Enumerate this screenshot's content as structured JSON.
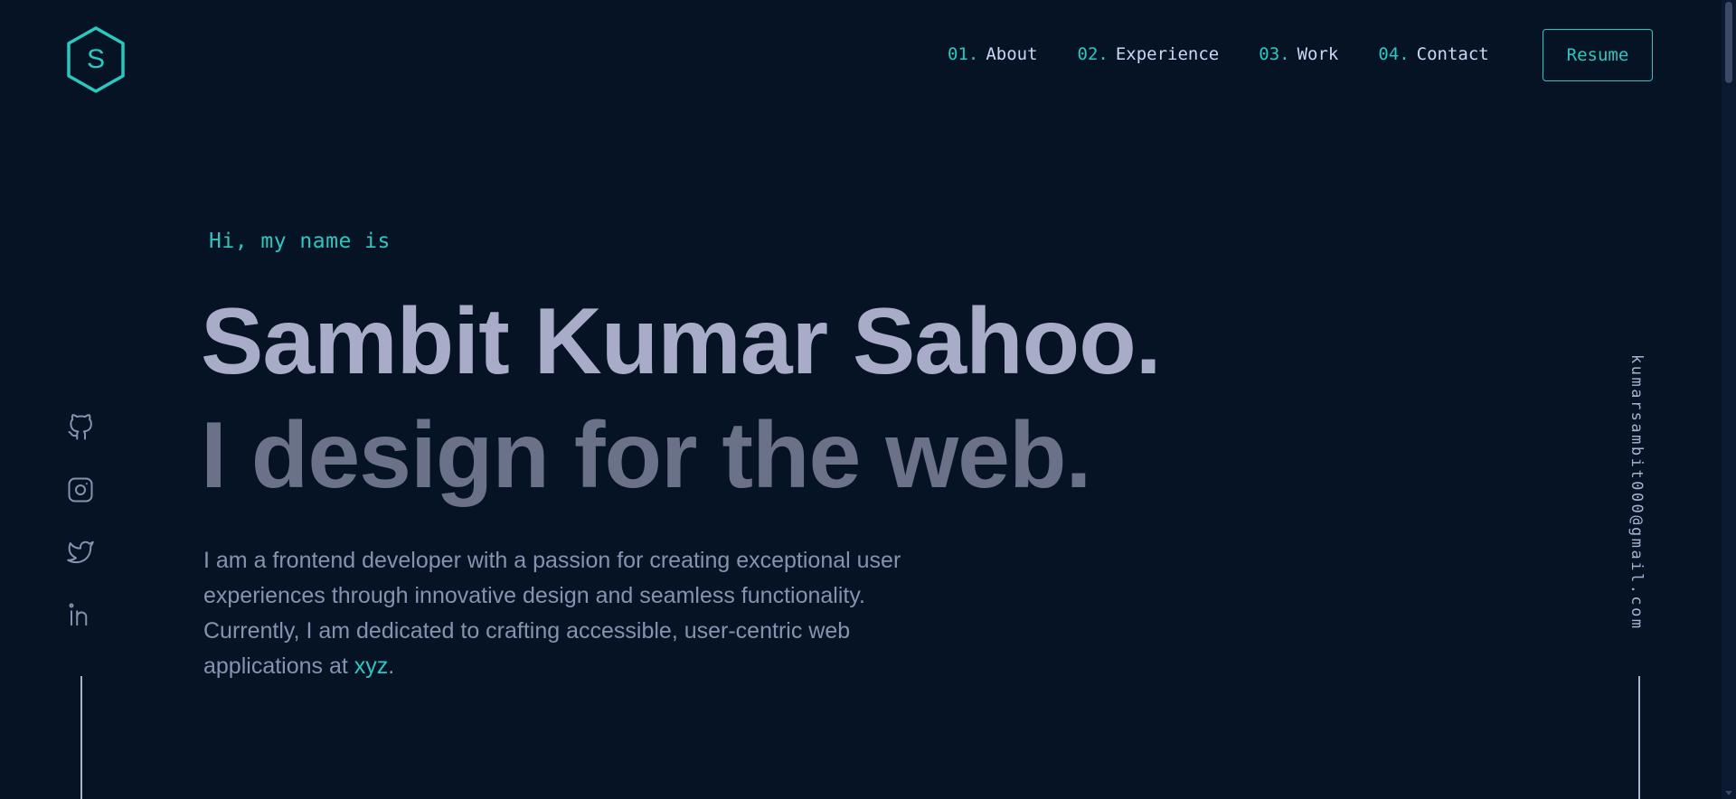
{
  "logo": {
    "letter": "S",
    "color": "#2bc8bf"
  },
  "nav": {
    "items": [
      {
        "num": "01.",
        "label": "About"
      },
      {
        "num": "02.",
        "label": "Experience"
      },
      {
        "num": "03.",
        "label": "Work"
      },
      {
        "num": "04.",
        "label": "Contact"
      }
    ],
    "resume_label": "Resume"
  },
  "hero": {
    "greeting": "Hi, my name is",
    "name": "Sambit Kumar Sahoo.",
    "tagline": "I design for the web.",
    "bio_text": "I am a frontend developer with a passion for creating exceptional user experiences through innovative design and seamless functionality. Currently, I am dedicated to crafting accessible, user-centric web applications at ",
    "bio_link": "xyz",
    "bio_end": "."
  },
  "social": {
    "icons": [
      "github-icon",
      "instagram-icon",
      "twitter-icon",
      "linkedin-icon"
    ]
  },
  "email": "kumarsambit000@gmail.com",
  "colors": {
    "background": "#061325",
    "accent": "#2bc8bf",
    "heading": "#a8acc9",
    "subheading": "#6a7188",
    "text": "#8892b0"
  }
}
